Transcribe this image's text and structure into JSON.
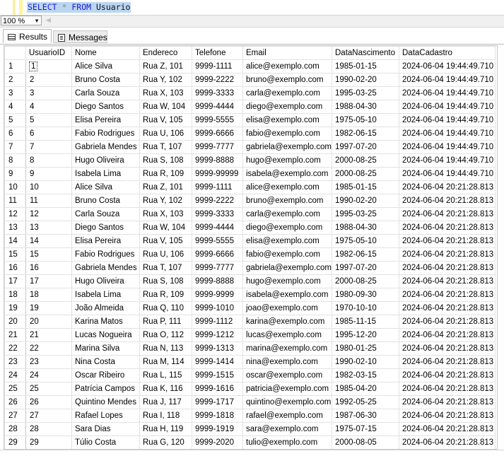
{
  "editor": {
    "kw_select": "SELECT",
    "op_star": "*",
    "kw_from": "FROM",
    "table_name": "Usuario"
  },
  "zoom": {
    "value": "100 %"
  },
  "tabs": [
    {
      "label": "Results",
      "icon": "grid-icon"
    },
    {
      "label": "Messages",
      "icon": "messages-icon"
    }
  ],
  "grid": {
    "columns": [
      "UsuarioID",
      "Nome",
      "Endereco",
      "Telefone",
      "Email",
      "DataNascimento",
      "DataCadastro"
    ],
    "rows": [
      [
        "1",
        "1",
        "Alice Silva",
        "Rua Z, 101",
        "9999-1111",
        "alice@exemplo.com",
        "1985-01-15",
        "2024-06-04 19:44:49.710"
      ],
      [
        "2",
        "2",
        "Bruno Costa",
        "Rua Y, 102",
        "9999-2222",
        "bruno@exemplo.com",
        "1990-02-20",
        "2024-06-04 19:44:49.710"
      ],
      [
        "3",
        "3",
        "Carla Souza",
        "Rua X, 103",
        "9999-3333",
        "carla@exemplo.com",
        "1995-03-25",
        "2024-06-04 19:44:49.710"
      ],
      [
        "4",
        "4",
        "Diego Santos",
        "Rua W, 104",
        "9999-4444",
        "diego@exemplo.com",
        "1988-04-30",
        "2024-06-04 19:44:49.710"
      ],
      [
        "5",
        "5",
        "Elisa Pereira",
        "Rua V, 105",
        "9999-5555",
        "elisa@exemplo.com",
        "1975-05-10",
        "2024-06-04 19:44:49.710"
      ],
      [
        "6",
        "6",
        "Fabio Rodrigues",
        "Rua U, 106",
        "9999-6666",
        "fabio@exemplo.com",
        "1982-06-15",
        "2024-06-04 19:44:49.710"
      ],
      [
        "7",
        "7",
        "Gabriela Mendes",
        "Rua T, 107",
        "9999-7777",
        "gabriela@exemplo.com",
        "1997-07-20",
        "2024-06-04 19:44:49.710"
      ],
      [
        "8",
        "8",
        "Hugo Oliveira",
        "Rua S, 108",
        "9999-8888",
        "hugo@exemplo.com",
        "2000-08-25",
        "2024-06-04 19:44:49.710"
      ],
      [
        "9",
        "9",
        "Isabela Lima",
        "Rua R, 109",
        "9999-99999",
        "isabela@exemplo.com",
        "2000-08-25",
        "2024-06-04 19:44:49.710"
      ],
      [
        "10",
        "10",
        "Alice Silva",
        "Rua Z, 101",
        "9999-1111",
        "alice@exemplo.com",
        "1985-01-15",
        "2024-06-04 20:21:28.813"
      ],
      [
        "11",
        "11",
        "Bruno Costa",
        "Rua Y, 102",
        "9999-2222",
        "bruno@exemplo.com",
        "1990-02-20",
        "2024-06-04 20:21:28.813"
      ],
      [
        "12",
        "12",
        "Carla Souza",
        "Rua X, 103",
        "9999-3333",
        "carla@exemplo.com",
        "1995-03-25",
        "2024-06-04 20:21:28.813"
      ],
      [
        "13",
        "13",
        "Diego Santos",
        "Rua W, 104",
        "9999-4444",
        "diego@exemplo.com",
        "1988-04-30",
        "2024-06-04 20:21:28.813"
      ],
      [
        "14",
        "14",
        "Elisa Pereira",
        "Rua V, 105",
        "9999-5555",
        "elisa@exemplo.com",
        "1975-05-10",
        "2024-06-04 20:21:28.813"
      ],
      [
        "15",
        "15",
        "Fabio Rodrigues",
        "Rua U, 106",
        "9999-6666",
        "fabio@exemplo.com",
        "1982-06-15",
        "2024-06-04 20:21:28.813"
      ],
      [
        "16",
        "16",
        "Gabriela Mendes",
        "Rua T, 107",
        "9999-7777",
        "gabriela@exemplo.com",
        "1997-07-20",
        "2024-06-04 20:21:28.813"
      ],
      [
        "17",
        "17",
        "Hugo Oliveira",
        "Rua S, 108",
        "9999-8888",
        "hugo@exemplo.com",
        "2000-08-25",
        "2024-06-04 20:21:28.813"
      ],
      [
        "18",
        "18",
        "Isabela Lima",
        "Rua R, 109",
        "9999-9999",
        "isabela@exemplo.com",
        "1980-09-30",
        "2024-06-04 20:21:28.813"
      ],
      [
        "19",
        "19",
        "João Almeida",
        "Rua Q, 110",
        "9999-1010",
        "joao@exemplo.com",
        "1970-10-10",
        "2024-06-04 20:21:28.813"
      ],
      [
        "20",
        "20",
        "Karina Matos",
        "Rua P, 111",
        "9999-1112",
        "karina@exemplo.com",
        "1985-11-15",
        "2024-06-04 20:21:28.813"
      ],
      [
        "21",
        "21",
        "Lucas Nogueira",
        "Rua O, 112",
        "9999-1212",
        "lucas@exemplo.com",
        "1995-12-20",
        "2024-06-04 20:21:28.813"
      ],
      [
        "22",
        "22",
        "Marina Silva",
        "Rua N, 113",
        "9999-1313",
        "marina@exemplo.com",
        "1980-01-25",
        "2024-06-04 20:21:28.813"
      ],
      [
        "23",
        "23",
        "Nina Costa",
        "Rua M, 114",
        "9999-1414",
        "nina@exemplo.com",
        "1990-02-10",
        "2024-06-04 20:21:28.813"
      ],
      [
        "24",
        "24",
        "Oscar Ribeiro",
        "Rua L, 115",
        "9999-1515",
        "oscar@exemplo.com",
        "1982-03-15",
        "2024-06-04 20:21:28.813"
      ],
      [
        "25",
        "25",
        "Patrícia Campos",
        "Rua K, 116",
        "9999-1616",
        "patricia@exemplo.com",
        "1985-04-20",
        "2024-06-04 20:21:28.813"
      ],
      [
        "26",
        "26",
        "Quintino Mendes",
        "Rua J, 117",
        "9999-1717",
        "quintino@exemplo.com",
        "1992-05-25",
        "2024-06-04 20:21:28.813"
      ],
      [
        "27",
        "27",
        "Rafael Lopes",
        "Rua I, 118",
        "9999-1818",
        "rafael@exemplo.com",
        "1987-06-30",
        "2024-06-04 20:21:28.813"
      ],
      [
        "28",
        "28",
        "Sara Dias",
        "Rua H, 119",
        "9999-1919",
        "sara@exemplo.com",
        "1975-07-15",
        "2024-06-04 20:21:28.813"
      ],
      [
        "29",
        "29",
        "Túlio Costa",
        "Rua G, 120",
        "9999-2020",
        "tulio@exemplo.com",
        "2000-08-05",
        "2024-06-04 20:21:28.813"
      ]
    ]
  }
}
